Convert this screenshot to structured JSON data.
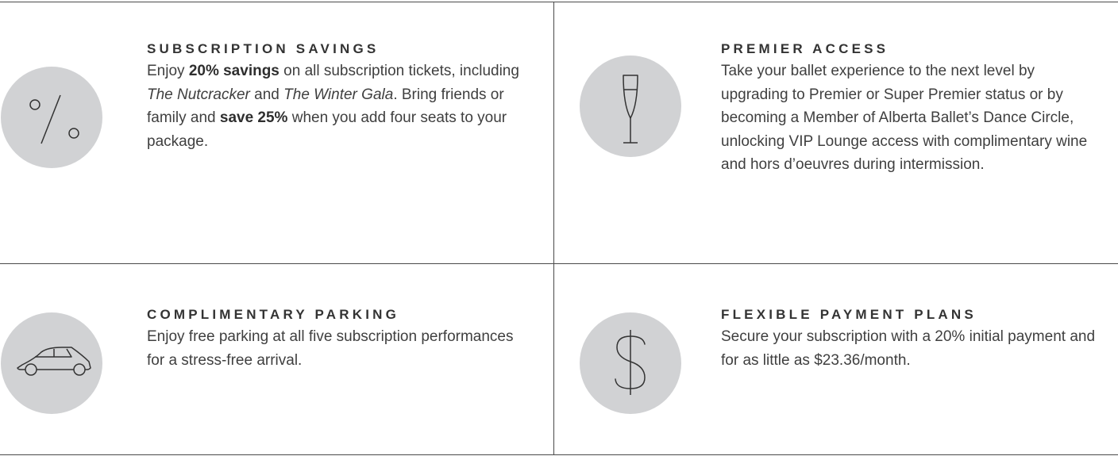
{
  "benefits": [
    {
      "icon": "percent-icon",
      "title": "SUBSCRIPTION SAVINGS",
      "body": [
        {
          "text": "Enjoy "
        },
        {
          "text": "20% savings",
          "style": "bold"
        },
        {
          "text": " on all subscription tickets, including "
        },
        {
          "text": "The Nutcracker",
          "style": "italic"
        },
        {
          "text": " and "
        },
        {
          "text": "The Winter Gala",
          "style": "italic"
        },
        {
          "text": ". Bring friends or family and "
        },
        {
          "text": "save 25%",
          "style": "bold"
        },
        {
          "text": " when you add four seats to your package."
        }
      ]
    },
    {
      "icon": "champagne-glass-icon",
      "title": "PREMIER ACCESS",
      "body": [
        {
          "text": "Take your ballet experience to the next level by upgrading to Premier or Super Premier status or by becoming a Member of Alberta Ballet’s Dance Circle, unlocking VIP Lounge access with complimentary wine and hors d’oeuvres during intermission."
        }
      ]
    },
    {
      "icon": "car-icon",
      "title": "COMPLIMENTARY PARKING",
      "body": [
        {
          "text": "Enjoy free parking at all five subscription performances for a stress-free arrival."
        }
      ]
    },
    {
      "icon": "dollar-sign-icon",
      "title": "FLEXIBLE PAYMENT PLANS",
      "body": [
        {
          "text": "Secure your subscription with a 20% initial payment and for as little as $23.36/month."
        }
      ]
    }
  ],
  "colors": {
    "circle": "#d1d2d4",
    "icon_stroke": "#333333",
    "rule": "#4a4a4a",
    "text": "#3f3f3f"
  }
}
